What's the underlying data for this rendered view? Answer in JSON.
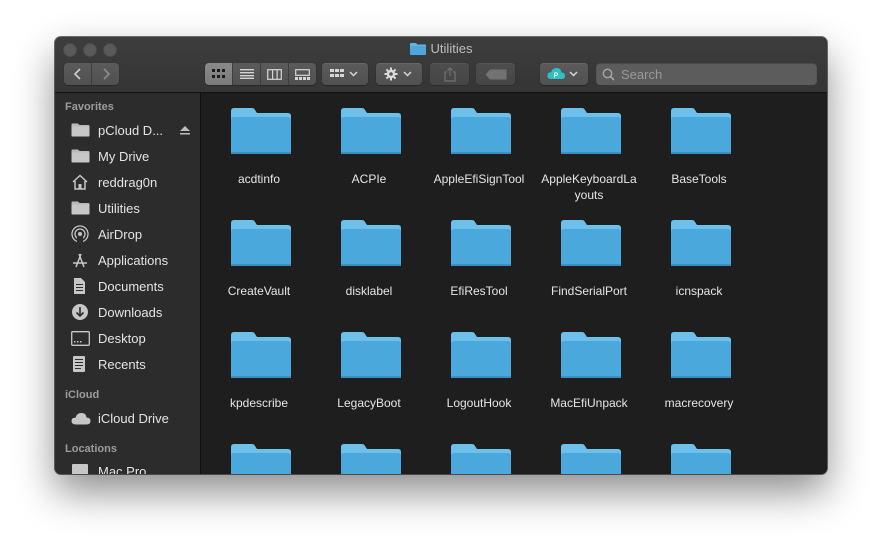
{
  "window": {
    "title": "Utilities"
  },
  "toolbar": {
    "back": "chevron-left-icon",
    "forward": "chevron-right-icon",
    "view_modes": [
      "icon-view",
      "list-view",
      "column-view",
      "gallery-view"
    ],
    "active_view": "icon-view",
    "group_by": "group-icon",
    "action": "gear-icon",
    "share": "share-icon",
    "tags": "tag-icon",
    "pcloud": "pcloud-icon",
    "search_placeholder": "Search"
  },
  "sidebar": {
    "favorites_header": "Favorites",
    "favorites": [
      {
        "label": "pCloud D...",
        "icon": "folder-icon"
      },
      {
        "label": "My Drive",
        "icon": "folder-icon"
      },
      {
        "label": "reddrag0n",
        "icon": "home-icon"
      },
      {
        "label": "Utilities",
        "icon": "folder-icon"
      },
      {
        "label": "AirDrop",
        "icon": "airdrop-icon"
      },
      {
        "label": "Applications",
        "icon": "applications-icon"
      },
      {
        "label": "Documents",
        "icon": "document-icon"
      },
      {
        "label": "Downloads",
        "icon": "download-icon"
      },
      {
        "label": "Desktop",
        "icon": "desktop-icon"
      },
      {
        "label": "Recents",
        "icon": "recents-icon"
      }
    ],
    "icloud_header": "iCloud",
    "icloud": [
      {
        "label": "iCloud Drive",
        "icon": "cloud-icon"
      }
    ],
    "locations_header": "Locations",
    "locations": [
      {
        "label": "Mac Pro",
        "icon": "computer-icon"
      }
    ]
  },
  "files": [
    {
      "name": "acdtinfo"
    },
    {
      "name": "ACPIe"
    },
    {
      "name": "AppleEfiSignTool"
    },
    {
      "name": "AppleKeyboardLayouts"
    },
    {
      "name": "BaseTools"
    },
    {
      "name": "CreateVault"
    },
    {
      "name": "disklabel"
    },
    {
      "name": "EfiResTool"
    },
    {
      "name": "FindSerialPort"
    },
    {
      "name": "icnspack"
    },
    {
      "name": "kpdescribe"
    },
    {
      "name": "LegacyBoot"
    },
    {
      "name": "LogoutHook"
    },
    {
      "name": "MacEfiUnpack"
    },
    {
      "name": "macrecovery"
    },
    {
      "name": ""
    },
    {
      "name": ""
    },
    {
      "name": ""
    },
    {
      "name": ""
    },
    {
      "name": ""
    }
  ],
  "colors": {
    "folder_top": "#6cc0e9",
    "folder_body": "#4aa6d9",
    "accent": "#2fc0c4"
  }
}
